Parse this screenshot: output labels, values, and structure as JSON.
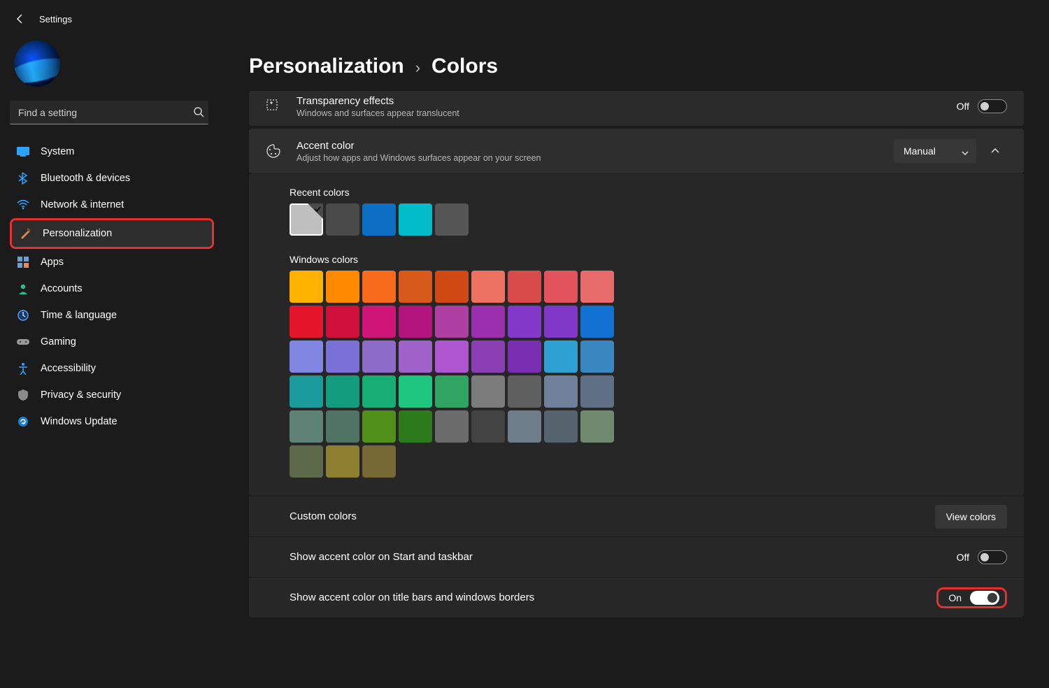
{
  "app_title": "Settings",
  "search": {
    "placeholder": "Find a setting"
  },
  "sidebar": {
    "items": [
      {
        "label": "System"
      },
      {
        "label": "Bluetooth & devices"
      },
      {
        "label": "Network & internet"
      },
      {
        "label": "Personalization"
      },
      {
        "label": "Apps"
      },
      {
        "label": "Accounts"
      },
      {
        "label": "Time & language"
      },
      {
        "label": "Gaming"
      },
      {
        "label": "Accessibility"
      },
      {
        "label": "Privacy & security"
      },
      {
        "label": "Windows Update"
      }
    ]
  },
  "breadcrumb": {
    "parent": "Personalization",
    "sep": "›",
    "current": "Colors"
  },
  "transparency": {
    "title": "Transparency effects",
    "sub": "Windows and surfaces appear translucent",
    "state_label": "Off"
  },
  "accent": {
    "title": "Accent color",
    "sub": "Adjust how apps and Windows surfaces appear on your screen",
    "mode": "Manual",
    "recent_label": "Recent colors",
    "recent_colors": [
      "#bfbfbf",
      "#4a4a4a",
      "#0d6fc4",
      "#00bcc9",
      "#565656"
    ],
    "windows_label": "Windows colors",
    "windows_colors": [
      "#ffb300",
      "#ff8a00",
      "#f76b1c",
      "#d85a1b",
      "#d14a16",
      "#ee7261",
      "#d84b4b",
      "#e2545c",
      "#e86b6b",
      "#e5152b",
      "#d0103a",
      "#cf1578",
      "#b3147e",
      "#b03fa3",
      "#9b2fae",
      "#8238c9",
      "#8038c9",
      "#1272d3",
      "#8286e3",
      "#7a70d6",
      "#8d6cc7",
      "#9e62c8",
      "#ae56cf",
      "#8a3fb3",
      "#7a2fb3",
      "#2fa0d2",
      "#3a88c2",
      "#1a9c9c",
      "#139c7e",
      "#17ae76",
      "#1fc77e",
      "#2fa561",
      "#7c7c7c",
      "#5f5f5f",
      "#6f809a",
      "#5f6f86",
      "#5f8276",
      "#4f7364",
      "#4f8f1a",
      "#2d7a1a",
      "#6c6c6c",
      "#434343",
      "#6d7e8a",
      "#54636e",
      "#6f8a6f",
      "#5c6a4a",
      "#8c7f2f",
      "#776936"
    ],
    "custom_label": "Custom colors",
    "custom_button": "View colors",
    "start_row": {
      "title": "Show accent color on Start and taskbar",
      "state_label": "Off"
    },
    "title_row": {
      "title": "Show accent color on title bars and windows borders",
      "state_label": "On"
    }
  }
}
